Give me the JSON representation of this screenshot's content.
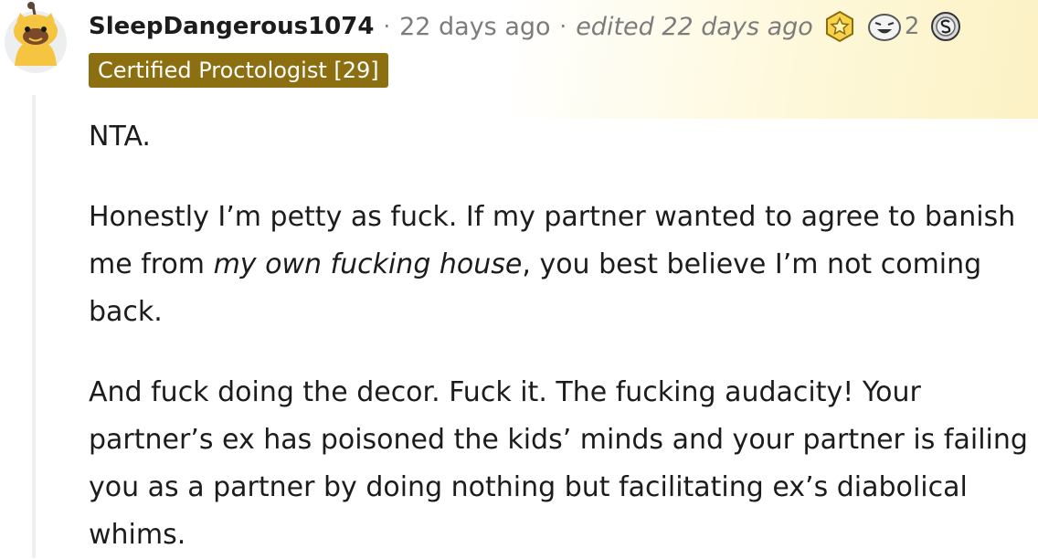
{
  "comment": {
    "username": "SleepDangerous1074",
    "separator": "·",
    "posted": "22 days ago",
    "edited": "edited 22 days ago",
    "awards": [
      {
        "icon": "gold-star-award-icon",
        "count": ""
      },
      {
        "icon": "laughing-face-award-icon",
        "count": "2"
      },
      {
        "icon": "silver-award-icon",
        "count": ""
      }
    ],
    "flair": "Certified Proctologist [29]",
    "paragraphs": {
      "p1": "NTA.",
      "p2_before": "Honestly I’m petty as fuck. If my partner wanted to agree to banish me from ",
      "p2_emphasis": "my own fucking house",
      "p2_after": ", you best believe I’m not coming back.",
      "p3": "And fuck doing the decor. Fuck it. The fucking audacity! Your partner’s ex has poisoned the kids’ minds and your partner is failing you as a partner by doing nothing but facilitating ex’s diabolical whims."
    }
  },
  "colors": {
    "flair_bg": "#8c6f10",
    "meta_text": "#7c7c7c",
    "thread_line": "#edeff1",
    "highlight": "#fcf0be"
  }
}
